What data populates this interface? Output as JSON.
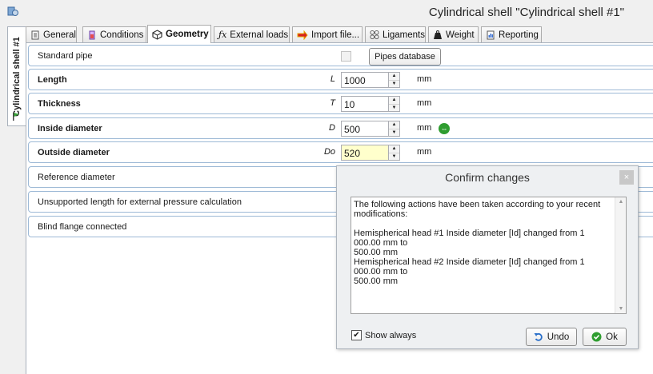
{
  "window": {
    "title": "Cylindrical shell \"Cylindrical shell #1\""
  },
  "side_tab": {
    "label": "Cylindrical shell #1"
  },
  "tabs": [
    {
      "label": "General",
      "icon": "document-icon"
    },
    {
      "label": "Conditions",
      "icon": "conditions-icon"
    },
    {
      "label": "Geometry",
      "icon": "geometry-icon",
      "active": true
    },
    {
      "label": "External loads",
      "icon": "function-icon"
    },
    {
      "label": "Import file...",
      "icon": "import-icon"
    },
    {
      "label": "Ligaments",
      "icon": "ligaments-icon"
    },
    {
      "label": "Weight",
      "icon": "weight-icon"
    },
    {
      "label": "Reporting",
      "icon": "report-icon"
    }
  ],
  "rows": {
    "standard_pipe": {
      "label": "Standard pipe",
      "button": "Pipes database"
    },
    "length": {
      "label": "Length",
      "symbol": "L",
      "value": "1000",
      "unit": "mm"
    },
    "thickness": {
      "label": "Thickness",
      "symbol": "T",
      "value": "10",
      "unit": "mm"
    },
    "inside_diameter": {
      "label": "Inside diameter",
      "symbol": "D",
      "value": "500",
      "unit": "mm"
    },
    "outside_diameter": {
      "label": "Outside diameter",
      "symbol": "Do",
      "value": "520",
      "unit": "mm"
    },
    "reference_diameter": {
      "label": "Reference diameter"
    },
    "unsupported_length": {
      "label": "Unsupported length for external pressure calculation"
    },
    "blind_flange": {
      "label": "Blind flange connected"
    }
  },
  "dialog": {
    "title": "Confirm changes",
    "close": "×",
    "message_line1": "The following actions have been taken according to your recent",
    "message_line2": "modifications:",
    "change1_line1": "Hemispherical head #1 Inside diameter [Id] changed from 1 000.00 mm to",
    "change1_line2": "500.00 mm",
    "change2_line1": "Hemispherical head #2 Inside diameter [Id] changed from 1 000.00 mm to",
    "change2_line2": "500.00 mm",
    "show_always_label": "Show always",
    "show_always_checked": true,
    "undo_label": "Undo",
    "ok_label": "Ok"
  },
  "colors": {
    "row_border": "#9db9d6",
    "highlight_input": "#ffffcc",
    "ok_icon": "#2f9d30",
    "undo_icon": "#2a6fc9"
  }
}
